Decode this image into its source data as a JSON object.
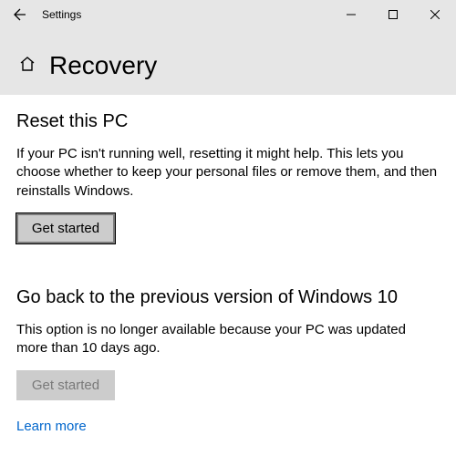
{
  "titlebar": {
    "app_name": "Settings"
  },
  "header": {
    "page_title": "Recovery"
  },
  "section1": {
    "heading": "Reset this PC",
    "desc": "If your PC isn't running well, resetting it might help. This lets you choose whether to keep your personal files or remove them, and then reinstalls Windows.",
    "button_label": "Get started"
  },
  "section2": {
    "heading": "Go back to the previous version of Windows 10",
    "desc": "This option is no longer available because your PC was updated more than 10 days ago.",
    "button_label": "Get started"
  },
  "link": {
    "learn_more": "Learn more"
  }
}
